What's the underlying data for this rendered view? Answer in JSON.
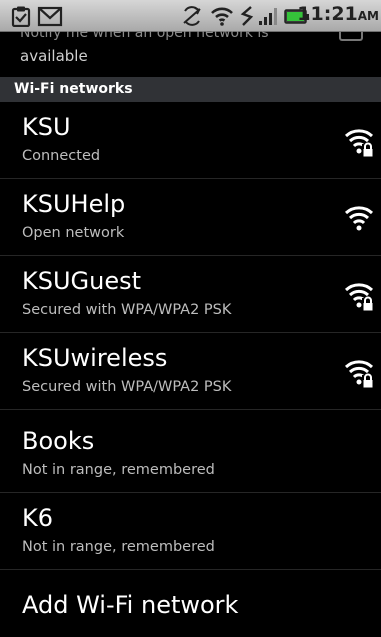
{
  "status_bar": {
    "time": "11:21",
    "ampm": "AM",
    "icons": [
      "clipboard-icon",
      "gmail-icon",
      "sync-icon",
      "wifi-icon",
      "signal-tower-icon",
      "signal-bars-icon",
      "battery-icon"
    ]
  },
  "top_setting": {
    "partial_text": "Notify me when an open network is",
    "continuation": "available"
  },
  "section": {
    "header": "Wi-Fi networks"
  },
  "networks": [
    {
      "name": "KSU",
      "status": "Connected",
      "icon": "wifi-locked-icon"
    },
    {
      "name": "KSUHelp",
      "status": "Open network",
      "icon": "wifi-open-icon"
    },
    {
      "name": "KSUGuest",
      "status": "Secured with WPA/WPA2 PSK",
      "icon": "wifi-locked-icon"
    },
    {
      "name": "KSUwireless",
      "status": "Secured with WPA/WPA2 PSK",
      "icon": "wifi-locked-icon"
    },
    {
      "name": "Books",
      "status": "Not in range, remembered",
      "icon": ""
    },
    {
      "name": "K6",
      "status": "Not in range, remembered",
      "icon": ""
    }
  ],
  "add_network": {
    "label": "Add Wi-Fi network"
  },
  "colors": {
    "background": "#000000",
    "header_bg": "#303236",
    "subtitle": "#bdbdbd",
    "status_bar": "#c4c4c4"
  }
}
